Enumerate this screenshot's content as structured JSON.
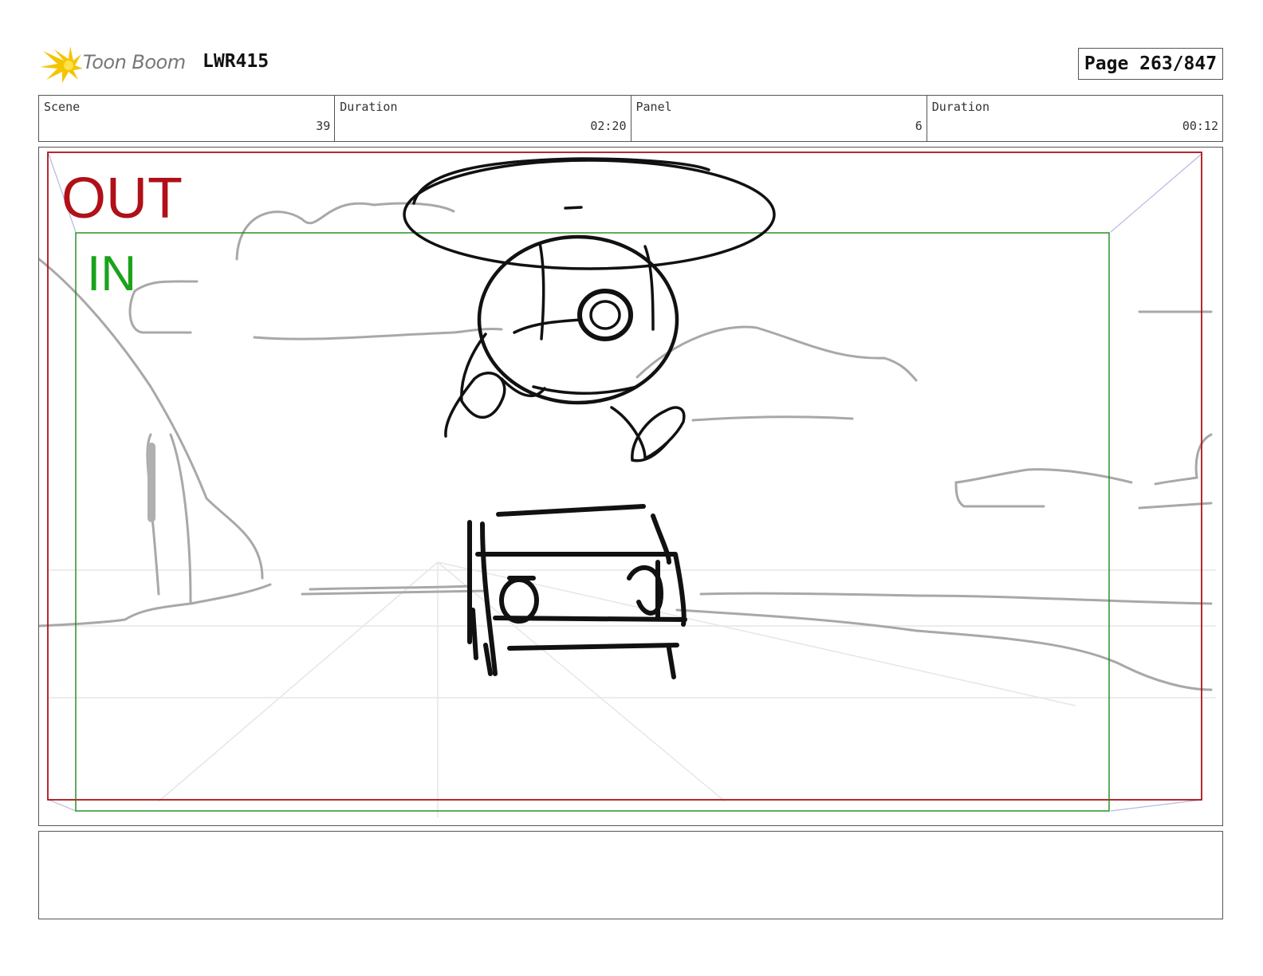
{
  "header": {
    "logo_text": "Toon Boom",
    "project_code": "LWR415",
    "page_label": "Page 263/847"
  },
  "info": {
    "scene_label": "Scene",
    "scene_value": "39",
    "scene_duration_label": "Duration",
    "scene_duration_value": "02:20",
    "panel_label": "Panel",
    "panel_value": "6",
    "panel_duration_label": "Duration",
    "panel_duration_value": "00:12"
  },
  "frame": {
    "out_label": "OUT",
    "in_label": "IN",
    "out_color": "#b01018",
    "in_color": "#1aa31a"
  },
  "notes": {
    "text": ""
  }
}
